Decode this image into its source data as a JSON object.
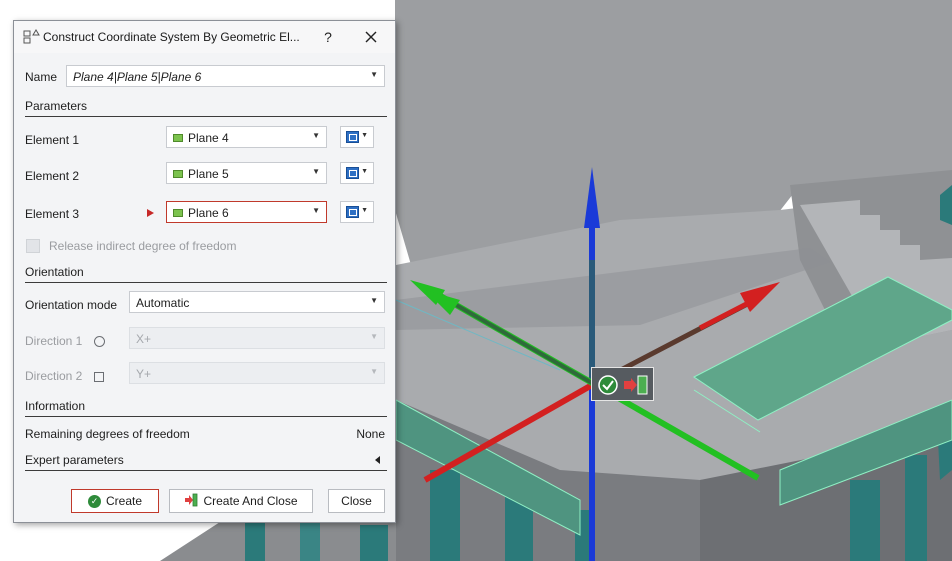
{
  "dialog": {
    "title": "Construct Coordinate System By Geometric El...",
    "help": "?",
    "name_label": "Name",
    "name_value": "Plane 4|Plane 5|Plane 6",
    "parameters_header": "Parameters",
    "elements": [
      {
        "label": "Element 1",
        "value": "Plane 4"
      },
      {
        "label": "Element 2",
        "value": "Plane 5"
      },
      {
        "label": "Element 3",
        "value": "Plane 6"
      }
    ],
    "release_label": "Release indirect degree of freedom",
    "orientation_header": "Orientation",
    "orientation_mode_label": "Orientation mode",
    "orientation_mode_value": "Automatic",
    "direction1_label": "Direction 1",
    "direction1_value": "X+",
    "direction2_label": "Direction 2",
    "direction2_value": "Y+",
    "information_header": "Information",
    "remaining_label": "Remaining degrees of freedom",
    "remaining_value": "None",
    "expert_header": "Expert parameters",
    "buttons": {
      "create": "Create",
      "create_and_close": "Create And Close",
      "close": "Close"
    }
  },
  "colors": {
    "axis_x": "#d32020",
    "axis_y": "#22c022",
    "axis_z": "#1a3ad8",
    "accent_border": "#c0392b",
    "plane_green": "#7cc34e"
  },
  "icons": [
    "construct-csys-icon",
    "close-icon",
    "plane-icon",
    "selection-filter-icon",
    "dropdown-arrow-icon",
    "check-icon",
    "create-and-close-icon",
    "collapse-icon"
  ]
}
